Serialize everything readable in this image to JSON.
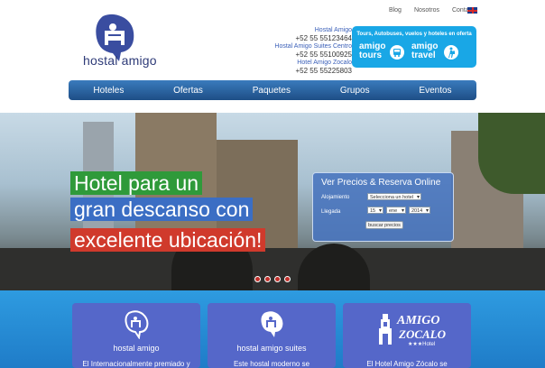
{
  "top_links": [
    "Blog",
    "Nosotros",
    "Contacto"
  ],
  "logo": {
    "text": "hostal amigo"
  },
  "contacts": [
    {
      "name": "Hostal Amigo",
      "phone": "+52 55 55123464"
    },
    {
      "name": "Hostal Amigo Suites Centro",
      "phone": "+52 55 55100925"
    },
    {
      "name": "Hotel Amigo Zocalo",
      "phone": "+52 55 55225803"
    }
  ],
  "travel": {
    "tagline": "Tours, Autobuses, vuelos y hoteles en oferta",
    "brand1": [
      "amigo",
      "tours"
    ],
    "brand2": [
      "amigo",
      "travel"
    ]
  },
  "nav": [
    "Hoteles",
    "Ofertas",
    "Paquetes",
    "Grupos",
    "Eventos"
  ],
  "hero": {
    "lines": [
      "Hotel para un",
      "gran descanso con",
      "excelente ubicación!"
    ],
    "colors": [
      "#2f9a3a",
      "#3b6ec4",
      "#d03a2c"
    ]
  },
  "booking": {
    "title": "Ver Precios & Reserva Online",
    "label_lodging": "Alojamiento",
    "lodging_value": "Selecciona un hotel",
    "label_arrival": "Llegada",
    "day": "15",
    "month": "ene",
    "year": "2014",
    "button": "buscar precios"
  },
  "cards": [
    {
      "name": "hostal amigo",
      "desc": "El Internacionalmente premiado y"
    },
    {
      "name": "hostal amigo suites",
      "desc": "Este hostal moderno se"
    },
    {
      "name": "AMIGO",
      "name2": "ZOCALO",
      "stars": "★★★Hotel",
      "desc": "El Hotel Amigo Zócalo se"
    }
  ]
}
